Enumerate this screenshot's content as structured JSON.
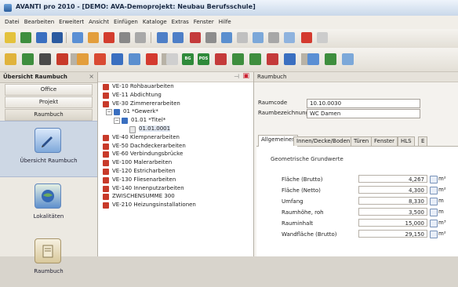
{
  "window": {
    "title": "AVANTI pro 2010 - [DEMO: AVA-Demoprojekt: Neubau Berufsschule]"
  },
  "menu": [
    "Datei",
    "Bearbeiten",
    "Erweitert",
    "Ansicht",
    "Einfügen",
    "Kataloge",
    "Extras",
    "Fenster",
    "Hilfe"
  ],
  "left_panel": {
    "header": "Übersicht Raumbuch",
    "nav_buttons": [
      "Office",
      "Projekt",
      "Raumbuch"
    ],
    "big_nav": [
      {
        "label": "Übersicht Raumbuch",
        "icon": "pencil-icon"
      },
      {
        "label": "Lokalitäten",
        "icon": "globe-icon"
      },
      {
        "label": "Raumbuch",
        "icon": "book-icon"
      }
    ]
  },
  "tree": {
    "items": [
      {
        "text": "VE-10 Rohbauarbeiten",
        "icon": "folder-red-icon"
      },
      {
        "text": "VE-11 Abdichtung",
        "icon": "folder-red-icon"
      },
      {
        "text": "VE-30 Zimmererarbeiten",
        "icon": "folder-red-icon"
      },
      {
        "text": "01 *Gewerk*",
        "icon": "folder-blue-icon"
      },
      {
        "text": "01.01 *Titel*",
        "icon": "folder-blue-icon"
      },
      {
        "text": "01.01.0001",
        "icon": "document-icon"
      },
      {
        "text": "VE-40 Klempnerarbeiten",
        "icon": "folder-red-icon"
      },
      {
        "text": "VE-50 Dachdeckerarbeiten",
        "icon": "folder-red-icon"
      },
      {
        "text": "VE-60 Verbindungsbrücke",
        "icon": "folder-red-icon"
      },
      {
        "text": "VE-100 Malerarbeiten",
        "icon": "folder-red-icon"
      },
      {
        "text": "VE-120 Estricharbeiten",
        "icon": "folder-red-icon"
      },
      {
        "text": "VE-130 Fliesenarbeiten",
        "icon": "folder-red-icon"
      },
      {
        "text": "VE-140 Innenputzarbeiten",
        "icon": "folder-red-icon"
      },
      {
        "text": "ZWISCHENSUMME 300",
        "icon": "folder-red-icon"
      },
      {
        "text": "VE-210 Heizungsinstallationen",
        "icon": "folder-red-icon"
      }
    ]
  },
  "right_panel": {
    "header": "Raumbuch",
    "raumcode_label": "Raumcode",
    "raumcode_value": "10.10.0030",
    "raumbez_label": "Raumbezeichnung",
    "raumbez_value": "WC Damen",
    "tabs": [
      "Allgemeines",
      "Innen/Decke/Boden",
      "Türen",
      "Fenster",
      "HLS",
      "E"
    ],
    "group_title": "Geometrische Grundwerte",
    "rows": [
      {
        "label": "Fläche (Brutto)",
        "value": "4,267",
        "unit": "m²"
      },
      {
        "label": "Fläche (Netto)",
        "value": "4,300",
        "unit": "m²"
      },
      {
        "label": "Umfang",
        "value": "8,330",
        "unit": "m"
      },
      {
        "label": "Raumhöhe, roh",
        "value": "3,500",
        "unit": "m"
      },
      {
        "label": "Rauminhalt",
        "value": "15,000",
        "unit": "m³"
      },
      {
        "label": "Wandfläche (Brutto)",
        "value": "29,150",
        "unit": "m²"
      }
    ]
  }
}
